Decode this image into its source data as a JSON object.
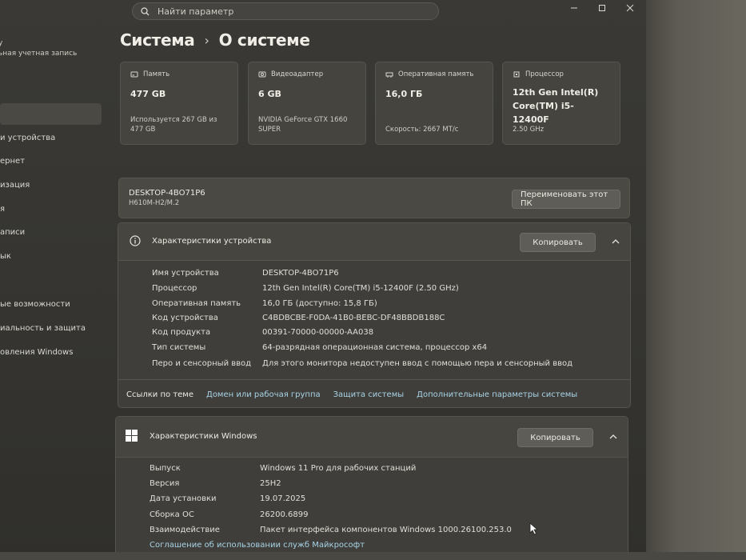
{
  "search": {
    "placeholder": "Найти параметр"
  },
  "sidebar": {
    "account": "ьная учетная запись",
    "account_top": "y",
    "items": [
      "и устройства",
      "ернет",
      "изация",
      "я",
      "аписи",
      "ык",
      "ые возможности",
      "иальность и защита",
      "овления Windows"
    ]
  },
  "header": {
    "section": "Система",
    "separator": "›",
    "page": "О системе"
  },
  "cards": [
    {
      "label": "Память",
      "icon": "storage-icon",
      "value": "477 GB",
      "sub": "Используется 267 GB из 477 GB"
    },
    {
      "label": "Видеоадаптер",
      "icon": "gpu-icon",
      "value": "6 GB",
      "sub": "NVIDIA GeForce GTX 1660 SUPER"
    },
    {
      "label": "Оперативная память",
      "icon": "ram-icon",
      "value": "16,0 ГБ",
      "sub": "Скорость: 2667 МТ/с"
    },
    {
      "label": "Процессор",
      "icon": "cpu-icon",
      "value": "12th Gen Intel(R) Core(TM) i5-12400F",
      "sub": "2.50 GHz"
    }
  ],
  "device": {
    "name": "DESKTOP-4BO71P6",
    "board": "H610M-H2/M.2",
    "rename_label": "Переименовать этот ПК"
  },
  "device_specs": {
    "title": "Характеристики устройства",
    "copy_label": "Копировать",
    "rows": [
      {
        "key": "Имя устройства",
        "value": "DESKTOP-4BO71P6"
      },
      {
        "key": "Процессор",
        "value": "12th Gen Intel(R) Core(TM) i5-12400F (2.50 GHz)"
      },
      {
        "key": "Оперативная память",
        "value": "16,0 ГБ (доступно: 15,8 ГБ)"
      },
      {
        "key": "Код устройства",
        "value": "C4BDBCBE-F0DA-41B0-BEBC-DF48BBDB188C"
      },
      {
        "key": "Код продукта",
        "value": "00391-70000-00000-AA038"
      },
      {
        "key": "Тип системы",
        "value": "64-разрядная операционная система, процессор x64"
      },
      {
        "key": "Перо и сенсорный ввод",
        "value": "Для этого монитора недоступен ввод с помощью пера и сенсорный ввод"
      }
    ],
    "links_label": "Ссылки по теме",
    "links": [
      "Домен или рабочая группа",
      "Защита системы",
      "Дополнительные параметры системы"
    ]
  },
  "windows_specs": {
    "title": "Характеристики Windows",
    "copy_label": "Копировать",
    "rows": [
      {
        "key": "Выпуск",
        "value": "Windows 11 Pro для рабочих станций"
      },
      {
        "key": "Версия",
        "value": "25H2"
      },
      {
        "key": "Дата установки",
        "value": "19.07.2025"
      },
      {
        "key": "Сборка ОС",
        "value": "26200.6899"
      },
      {
        "key": "Взаимодействие",
        "value": "Пакет интерфейса компонентов Windows 1000.26100.253.0"
      }
    ],
    "bottom_link": "Соглашение об использовании служб Майкрософт"
  },
  "colors": {
    "link": "#a8d3e6",
    "accent_windows": "#ffffff"
  }
}
